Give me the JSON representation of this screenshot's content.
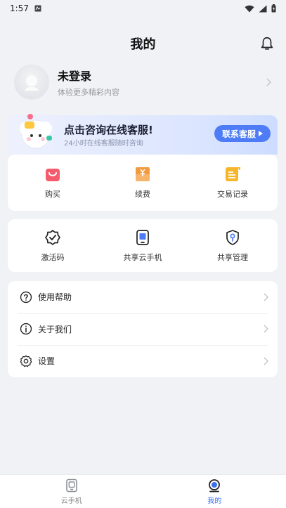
{
  "status_bar": {
    "time": "1:57"
  },
  "header": {
    "title": "我的"
  },
  "profile": {
    "name": "未登录",
    "subtitle": "体验更多精彩内容"
  },
  "service": {
    "title": "点击咨询在线客服!",
    "subtitle": "24小时在线客服随时咨询",
    "button_label": "联系客服",
    "items": [
      {
        "label": "购买",
        "icon": "shopping-bag-icon"
      },
      {
        "label": "续费",
        "icon": "renew-icon"
      },
      {
        "label": "交易记录",
        "icon": "transaction-record-icon"
      }
    ]
  },
  "share": {
    "items": [
      {
        "label": "激活码",
        "icon": "activation-code-icon"
      },
      {
        "label": "共享云手机",
        "icon": "cloud-phone-icon"
      },
      {
        "label": "共享管理",
        "icon": "share-manage-icon"
      }
    ]
  },
  "menu": {
    "items": [
      {
        "label": "使用帮助",
        "icon": "help-icon"
      },
      {
        "label": "关于我们",
        "icon": "info-icon"
      },
      {
        "label": "设置",
        "icon": "gear-icon"
      }
    ]
  },
  "tabbar": {
    "items": [
      {
        "label": "云手机",
        "icon": "cloud-phone-icon",
        "active": false
      },
      {
        "label": "我的",
        "icon": "profile-icon",
        "active": true
      }
    ]
  },
  "colors": {
    "accent": "#4d7cf6",
    "background": "#f1f2f6",
    "buy": "#f45b6c",
    "renew": "#f19a3e",
    "record": "#f7b52a"
  }
}
